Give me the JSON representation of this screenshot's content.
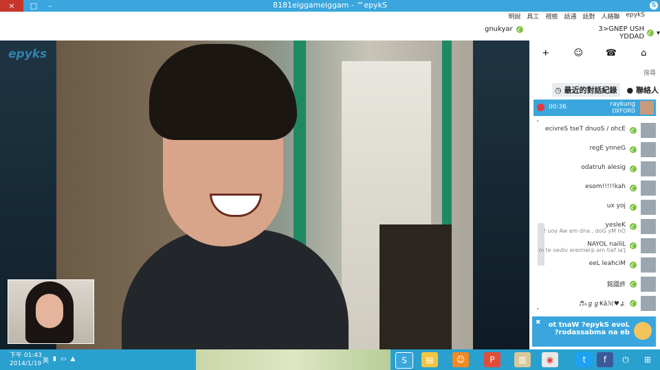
{
  "window": {
    "title": "Skype™ - maggiemaggie1818",
    "app_icon": "skype-icon",
    "close_glyph": "×",
    "max_glyph": "□",
    "min_glyph": "–"
  },
  "menu": [
    "Skype",
    "聯絡人",
    "對話",
    "通話",
    "檢視",
    "工具",
    "說明"
  ],
  "header": {
    "call_contact": "raykung",
    "user_name": "HSU PENG<3 DADDY"
  },
  "video": {
    "logo": "skype"
  },
  "sidebar": {
    "search_placeholder": "搜尋",
    "tab_contacts": "聯絡人",
    "tab_recent": "最近的對話紀錄",
    "active_call": {
      "name": "raykung",
      "status": "OXFORD",
      "duration": "00:36"
    },
    "contacts": [
      {
        "name": "Echo / Sound Test Service",
        "subtitle": ""
      },
      {
        "name": "Genny  Eger",
        "subtitle": ""
      },
      {
        "name": "gisela hurtado",
        "subtitle": ""
      },
      {
        "name": "hak!!!!!mose",
        "subtitle": ""
      },
      {
        "name": "joy xu",
        "subtitle": ""
      },
      {
        "name": "Kelsey",
        "subtitle": "Oh My God , and me wA you !"
      },
      {
        "name": "Lilian LOYAN",
        "subtitle": "J'ai fait ma premiere video et m"
      },
      {
        "name": "Michael Lee",
        "subtitle": ""
      },
      {
        "name": "許國銘",
        "subtitle": ""
      },
      {
        "name": "ょ♥ℳã₭ℊℊℴ♬",
        "subtitle": ""
      }
    ],
    "ad": {
      "text": "Love Skype? Want to be an ambassador?"
    }
  },
  "taskbar": {
    "time": "下午 01:43",
    "date": "2014/1/19",
    "ime": "英"
  }
}
